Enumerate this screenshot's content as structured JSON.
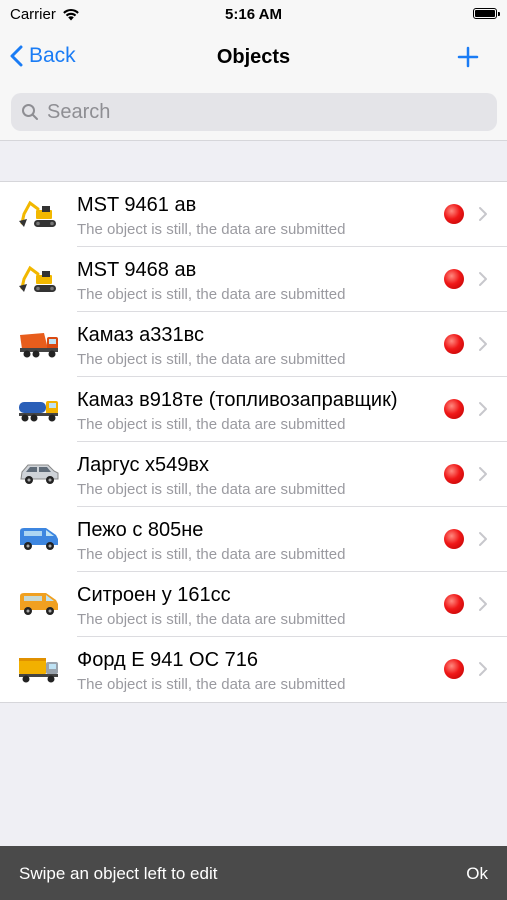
{
  "status_bar": {
    "carrier": "Carrier",
    "time": "5:16 AM"
  },
  "nav": {
    "back_label": "Back",
    "title": "Objects",
    "add_icon": "plus-icon"
  },
  "search": {
    "placeholder": "Search"
  },
  "objects": [
    {
      "name": "MST 9461 ав",
      "status": "The object is still, the data are submitted",
      "icon": "excavator-icon",
      "color": "#f2b800"
    },
    {
      "name": "MST 9468 ав",
      "status": "The object is still, the data are submitted",
      "icon": "excavator-icon",
      "color": "#f2b800"
    },
    {
      "name": "Камаз а331вс",
      "status": "The object is still, the data are submitted",
      "icon": "dump-truck-icon",
      "color": "#e85d1c"
    },
    {
      "name": "Камаз в918те (топливозаправщик)",
      "status": "The object is still, the data are submitted",
      "icon": "tanker-truck-icon",
      "color": "#2a5fb8"
    },
    {
      "name": "Ларгус х549вх",
      "status": "The object is still, the data are submitted",
      "icon": "car-icon",
      "color": "#cfd3d8"
    },
    {
      "name": "Пежо с 805не",
      "status": "The object is still, the data are submitted",
      "icon": "van-icon",
      "color": "#3d86e0"
    },
    {
      "name": "Ситроен у 161сс",
      "status": "The object is still, the data are submitted",
      "icon": "van-icon",
      "color": "#f0a020"
    },
    {
      "name": "Форд Е 941 ОС 716",
      "status": "The object is still, the data are submitted",
      "icon": "truck-icon",
      "color": "#f2b000"
    }
  ],
  "status_dot_color": "#e81919",
  "toast": {
    "message": "Swipe an object left to edit",
    "action": "Ok"
  }
}
